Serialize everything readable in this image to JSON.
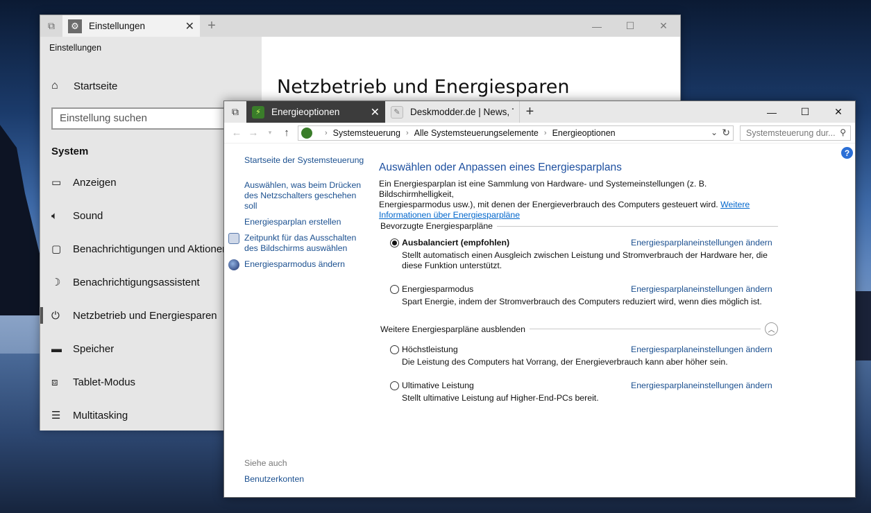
{
  "settings_window": {
    "tab_title": "Einstellungen",
    "app_title": "Einstellungen",
    "home_label": "Startseite",
    "search_placeholder": "Einstellung suchen",
    "group_title": "System",
    "nav_items": [
      {
        "label": "Anzeigen",
        "icon": "monitor-icon"
      },
      {
        "label": "Sound",
        "icon": "speaker-icon"
      },
      {
        "label": "Benachrichtigungen und Aktionen",
        "icon": "notification-icon"
      },
      {
        "label": "Benachrichtigungsassistent",
        "icon": "moon-icon"
      },
      {
        "label": "Netzbetrieb und Energiesparen",
        "icon": "power-icon",
        "selected": true
      },
      {
        "label": "Speicher",
        "icon": "storage-icon"
      },
      {
        "label": "Tablet-Modus",
        "icon": "tablet-icon"
      },
      {
        "label": "Multitasking",
        "icon": "multitasking-icon"
      }
    ],
    "page_heading": "Netzbetrieb und Energiesparen"
  },
  "cp_window": {
    "tabs": [
      {
        "label": "Energieoptionen",
        "active": true
      },
      {
        "label": "Deskmodder.de | News, Tip",
        "active": false
      }
    ],
    "breadcrumb": [
      "Systemsteuerung",
      "Alle Systemsteuerungselemente",
      "Energieoptionen"
    ],
    "search_placeholder": "Systemsteuerung dur...",
    "sidebar": {
      "links": [
        "Startseite der Systemsteuerung",
        "Auswählen, was beim Drücken",
        "des Netzschalters geschehen",
        "soll",
        "Energiesparplan erstellen",
        "Zeitpunkt für das Ausschalten",
        "des Bildschirms auswählen",
        "Energiesparmodus ändern"
      ],
      "see_also": "Siehe auch",
      "see_also_link": "Benutzerkonten"
    },
    "main": {
      "heading": "Auswählen oder Anpassen eines Energiesparplans",
      "intro_line1": "Ein Energiesparplan ist eine Sammlung von Hardware- und Systemeinstellungen (z. B. Bildschirmhelligkeit,",
      "intro_line2a": "Energiesparmodus usw.), mit denen der Energieverbrauch des Computers gesteuert wird. ",
      "intro_link1": "Weitere",
      "intro_link2": "Informationen über Energiesparpläne",
      "preferred_section": "Bevorzugte Energiesparpläne",
      "hidden_section": "Weitere Energiesparpläne ausblenden",
      "change_link": "Energiesparplaneinstellungen ändern",
      "plans": [
        {
          "name": "Ausbalanciert (empfohlen)",
          "selected": true,
          "desc1": "Stellt automatisch einen Ausgleich zwischen Leistung und Stromverbrauch der Hardware her, die",
          "desc2": "diese Funktion unterstützt."
        },
        {
          "name": "Energiesparmodus",
          "selected": false,
          "desc1": "Spart Energie, indem der Stromverbrauch des Computers reduziert wird, wenn dies möglich ist.",
          "desc2": ""
        },
        {
          "name": "Höchstleistung",
          "selected": false,
          "desc1": "Die Leistung des Computers hat Vorrang, der Energieverbrauch kann aber höher sein.",
          "desc2": ""
        },
        {
          "name": "Ultimative Leistung",
          "selected": false,
          "desc1": "Stellt ultimative Leistung auf Higher-End-PCs bereit.",
          "desc2": ""
        }
      ]
    }
  }
}
